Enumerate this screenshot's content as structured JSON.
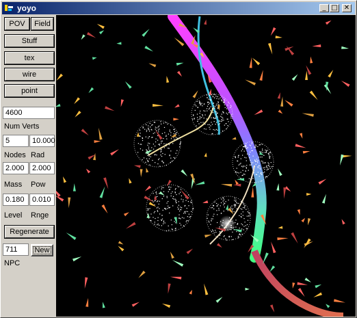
{
  "window": {
    "title": "yoyo"
  },
  "titlebar_buttons": {
    "minimize": "_",
    "maximize": "□",
    "close": "✕"
  },
  "panel": {
    "pov_label": "POV",
    "field_label": "Field",
    "stuff_label": "Stuff",
    "tex_label": "tex",
    "wire_label": "wire",
    "point_label": "point",
    "num_verts_value": "4600",
    "num_verts_label": "Num Verts",
    "nodes_value": "5",
    "rad_value": "10.000",
    "nodes_label": "Nodes",
    "rad_label": "Rad",
    "mass_value": "2.000",
    "pow_value": "2.000",
    "mass_label": "Mass",
    "pow_label": "Pow",
    "level_value": "0.180",
    "rnge_value": "0.010",
    "level_label": "Level",
    "rnge_label": "Rnge",
    "regenerate_label": "Regenerate",
    "npc_value": "711",
    "new_label": "New",
    "npc_label": "NPC"
  },
  "colors": {
    "background": "#000000",
    "ribbon_top": "#ff40ff",
    "ribbon_mid": "#8080ff",
    "ribbon_low": "#c04040",
    "dust": "#ffffff"
  }
}
